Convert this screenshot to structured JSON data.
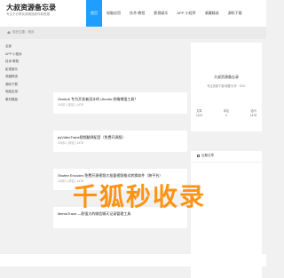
{
  "header": {
    "logo_title": "大叔资源备忘录",
    "logo_subtitle": "专注于分享实用精品软件和资源",
    "nav": [
      "首页",
      "电脑应用",
      "技术·教程",
      "影视娱乐",
      "APP·小程序",
      "收藏精选",
      "源码下载"
    ],
    "active_index": 0
  },
  "breadcrumb": {
    "text": "现在位置：首页"
  },
  "sidebar": {
    "items": [
      "全部",
      "APP·小程序",
      "技术·教程",
      "影视娱乐",
      "收藏精选",
      "源码下载",
      "电脑应用",
      "素材模板"
    ]
  },
  "articles": [
    {
      "title": "Onekuh 专为开发者设计的 Ubuntu 终端增强工具？",
      "meta": "11月2 | 评论 | 1478"
    },
    {
      "title": "pyVideoTrans视频翻译配音（免费开源版）",
      "meta": "10月2 | 评论 | 1478"
    },
    {
      "title": "Shutter Encoder-免费开源视频大批量视频格式转换软件（跨平台）",
      "meta": "10月2 | 评论 | 1478"
    },
    {
      "title": "MemoTrace —款强大的微信聊天记录管理工具",
      "meta": ""
    }
  ],
  "profile": {
    "name": "大叔资源备忘录",
    "desc": "专注资源下载/收藏/分享 · 2021",
    "stats": [
      {
        "value": "文章",
        "label": "1123"
      },
      {
        "value": "评论",
        "label": "0"
      },
      {
        "value": "访问",
        "label": "1478"
      }
    ]
  },
  "latest": {
    "label": "近期文章"
  },
  "watermark": "千狐秒收录",
  "colors": {
    "accent": "#1e9fff",
    "watermark": "#ff8c00"
  }
}
